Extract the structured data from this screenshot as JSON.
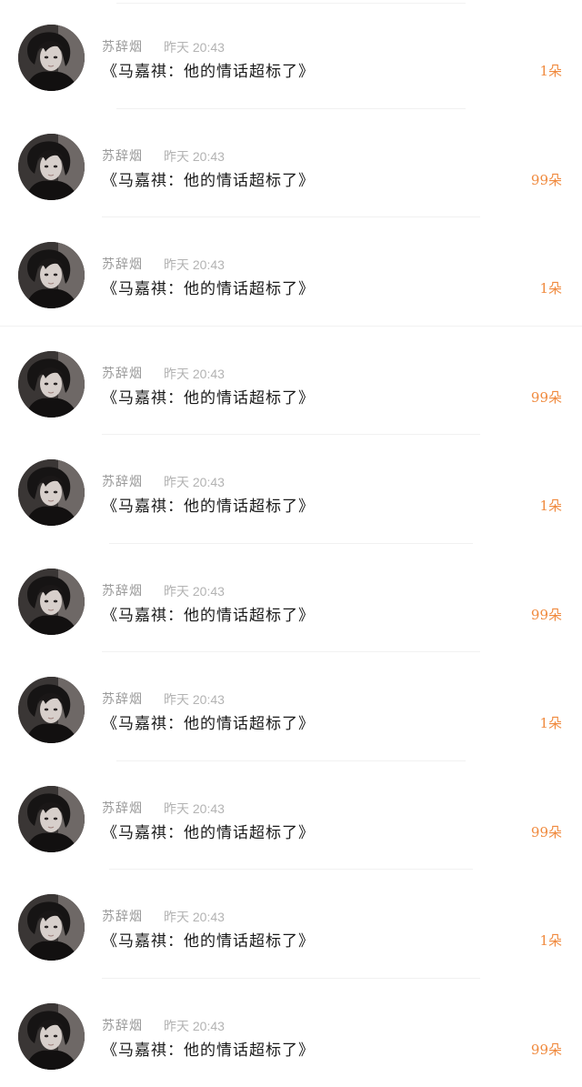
{
  "items": [
    {
      "author": "苏辞烟",
      "time": "昨天 20:43",
      "title": "《马嘉祺：他的情话超标了》",
      "count": "1朵"
    },
    {
      "author": "苏辞烟",
      "time": "昨天 20:43",
      "title": "《马嘉祺：他的情话超标了》",
      "count": "99朵"
    },
    {
      "author": "苏辞烟",
      "time": "昨天 20:43",
      "title": "《马嘉祺：他的情话超标了》",
      "count": "1朵"
    },
    {
      "author": "苏辞烟",
      "time": "昨天 20:43",
      "title": "《马嘉祺：他的情话超标了》",
      "count": "99朵"
    },
    {
      "author": "苏辞烟",
      "time": "昨天 20:43",
      "title": "《马嘉祺：他的情话超标了》",
      "count": "1朵"
    },
    {
      "author": "苏辞烟",
      "time": "昨天 20:43",
      "title": "《马嘉祺：他的情话超标了》",
      "count": "99朵"
    },
    {
      "author": "苏辞烟",
      "time": "昨天 20:43",
      "title": "《马嘉祺：他的情话超标了》",
      "count": "1朵"
    },
    {
      "author": "苏辞烟",
      "time": "昨天 20:43",
      "title": "《马嘉祺：他的情话超标了》",
      "count": "99朵"
    },
    {
      "author": "苏辞烟",
      "time": "昨天 20:43",
      "title": "《马嘉祺：他的情话超标了》",
      "count": "1朵"
    },
    {
      "author": "苏辞烟",
      "time": "昨天 20:43",
      "title": "《马嘉祺：他的情话超标了》",
      "count": "99朵"
    }
  ],
  "colors": {
    "count_accent": "#f08a3e",
    "author_text": "#9a9a9a",
    "time_text": "#b3b3b3",
    "title_text": "#1a1a1a"
  },
  "icons": {
    "avatar": "user-avatar-photo"
  }
}
